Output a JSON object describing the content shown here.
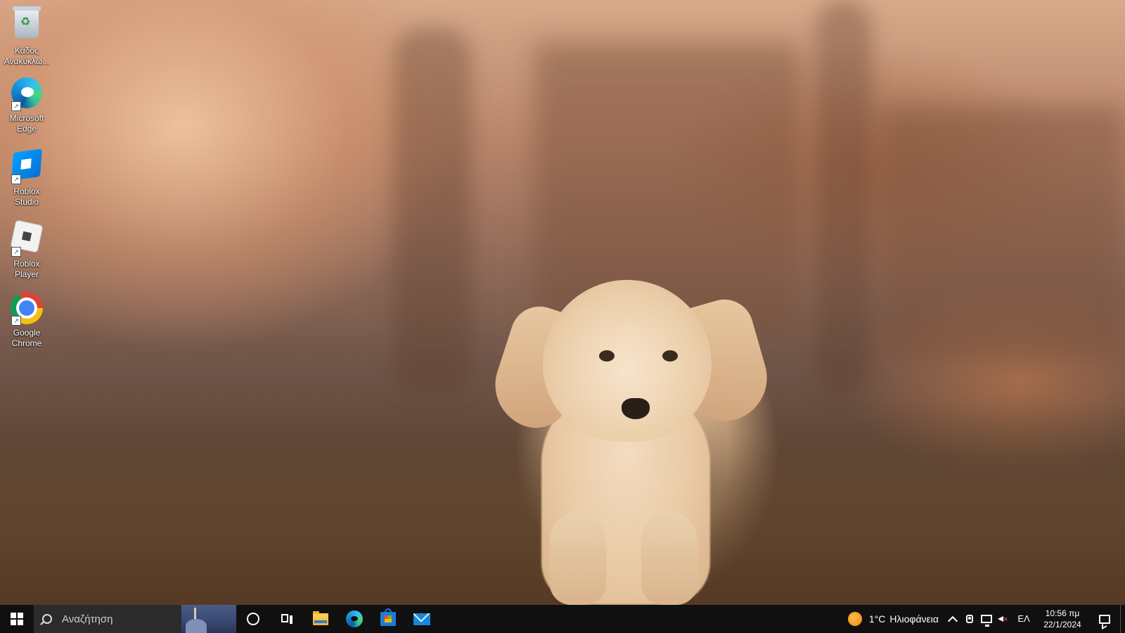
{
  "desktop": {
    "wallpaper": "blurred-park-puppy-photo",
    "icons": [
      {
        "label": "Κάδος Ανακύκλω...",
        "icon": "recycle-bin-icon"
      },
      {
        "label": "Microsoft Edge",
        "icon": "edge-icon"
      },
      {
        "label": "Roblox Studio",
        "icon": "roblox-studio-icon"
      },
      {
        "label": "Roblox Player",
        "icon": "roblox-player-icon"
      },
      {
        "label": "Google Chrome",
        "icon": "chrome-icon"
      }
    ]
  },
  "taskbar": {
    "start_icon": "windows-logo-icon",
    "search_placeholder": "Αναζήτηση",
    "pinned_apps": [
      "file-explorer-icon",
      "edge-icon",
      "microsoft-store-icon",
      "mail-icon"
    ],
    "weather": {
      "temp": "1°C",
      "condition": "Ηλιοφάνεια",
      "icon": "sun-icon"
    },
    "tray_icons": [
      "chevron-up-icon",
      "meet-now-icon",
      "network-icon",
      "volume-muted-icon"
    ],
    "language": "ΕΛ",
    "clock": {
      "time": "10:56 πμ",
      "date": "22/1/2024"
    },
    "notification_icon": "action-center-icon"
  },
  "colors": {
    "taskbar": "#101010",
    "search_box": "#2b2b2b",
    "weather_sun": "#f28a0c"
  }
}
